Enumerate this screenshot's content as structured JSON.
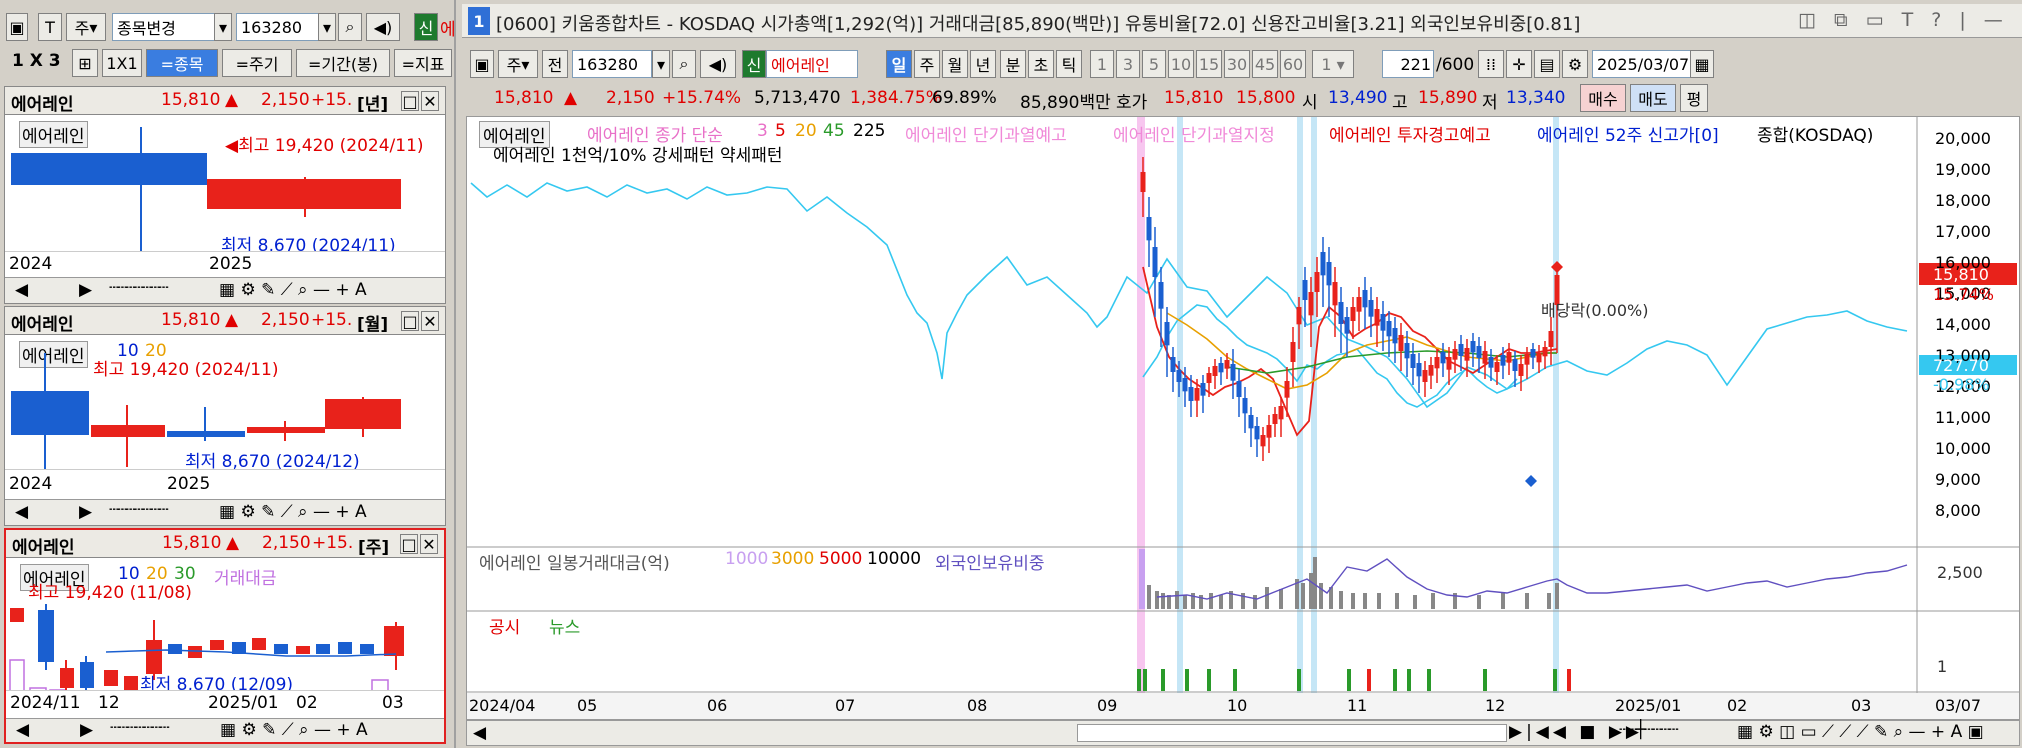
{
  "left": {
    "toolbar": {
      "mode_label": "주",
      "code_label": "종목변경",
      "code_value": "163280",
      "new_badge": "신",
      "trail": "에"
    },
    "row2": {
      "layout": "1 X 3",
      "layout_btn": "1X1",
      "tabs": [
        "=종목",
        "=주기",
        "=기간(봉)",
        "=지표"
      ]
    },
    "panels": [
      {
        "title": "에어레인",
        "price": "15,810",
        "arrow": "▲",
        "change": "2,150",
        "pct": "+15.",
        "period": "[년]",
        "legend_name": "에어레인",
        "ma": [],
        "high_text": "최고 19,420 (2024/11)",
        "low_text": "최저 8,670 (2024/11)",
        "xticks": [
          "2024",
          "2025"
        ]
      },
      {
        "title": "에어레인",
        "price": "15,810",
        "arrow": "▲",
        "change": "2,150",
        "pct": "+15.",
        "period": "[월]",
        "legend_name": "에어레인",
        "ma": [
          "10",
          "20"
        ],
        "high_text": "최고 19,420 (2024/11)",
        "low_text": "최저 8,670 (2024/12)",
        "xticks": [
          "2024",
          "2025"
        ]
      },
      {
        "title": "에어레인",
        "price": "15,810",
        "arrow": "▲",
        "change": "2,150",
        "pct": "+15.",
        "period": "[주]",
        "legend_name": "에어레인",
        "ma": [
          "10",
          "20",
          "30"
        ],
        "extra": "거래대금",
        "high_text": "최고 19,420 (11/08)",
        "low_text": "최저 8,670 (12/09)",
        "xticks": [
          "2024/11",
          "12",
          "2025/01",
          "02",
          "03"
        ]
      }
    ],
    "colors": {
      "up": "#e8221b",
      "down": "#1a5fd0"
    }
  },
  "right": {
    "title": "[0600] 키움종합차트 - KOSDAQ 시가총액[1,292(억)] 거래대금[85,890(백만)] 유통비율[72.0] 신용잔고비율[3.21] 외국인보유비중[0.81]",
    "window_no": "1",
    "toolbar": {
      "mode": "주",
      "prev": "전",
      "code": "163280",
      "new_badge": "신",
      "name": "에어레인",
      "periods": [
        "일",
        "주",
        "월",
        "년",
        "분",
        "초",
        "틱"
      ],
      "numbers": [
        "1",
        "3",
        "5",
        "10",
        "15",
        "30",
        "45",
        "60"
      ],
      "multiplier": "1",
      "count": "221",
      "count_max": "/600",
      "date": "2025/03/07"
    },
    "quote": {
      "price": "15,810",
      "arrow": "▲",
      "change": "2,150",
      "pct": "+15.74%",
      "volume": "5,713,470",
      "vol_ratio": "1,384.75%",
      "turnover": "69.89%",
      "amount": "85,890백만",
      "hoga_label": "호가",
      "hoga1": "15,810",
      "hoga2": "15,800",
      "open_label": "시",
      "open": "13,490",
      "high_label": "고",
      "high": "15,890",
      "low_label": "저",
      "low": "13,340",
      "buy": "매수",
      "sell": "매도",
      "eval": "평"
    },
    "legend1": {
      "name": "에어레인",
      "close_label": "에어레인 종가 단순",
      "ma": [
        "3",
        "5",
        "20",
        "45",
        "225"
      ],
      "warn1": "에어레인 단기과열예고",
      "warn2": "에어레인 단기과열지정",
      "warn3": "에어레인 투자경고예고",
      "new_high": "에어레인 52주 신고가[0]",
      "index": "종합(KOSDAQ)",
      "line2": "에어레인 1천억/10% 강세패턴  약세패턴"
    },
    "legend2": {
      "label": "에어레인 일봉거래대금(억)",
      "levels": [
        "1000",
        "3000",
        "5000",
        "10000"
      ],
      "foreign": "외국인보유비중"
    },
    "legend3": {
      "disclosure": "공시",
      "news": "뉴스"
    },
    "annotation": "배당락(0.00%)",
    "price_axis": [
      "20,000",
      "19,000",
      "18,000",
      "17,000",
      "16,000",
      "15,000",
      "14,000",
      "13,000",
      "12,000",
      "11,000",
      "10,000",
      "9,000",
      "8,000"
    ],
    "price_tag": "15,810",
    "pct_tag": "15.74%",
    "index_tag": "727.70",
    "index_pct": "-0.98%",
    "vol_axis": "2,500",
    "news_axis": "1",
    "xticks": [
      "2024/04",
      "05",
      "06",
      "07",
      "08",
      "09",
      "10",
      "11",
      "12",
      "2025/01",
      "02",
      "03",
      "03/07"
    ],
    "colors": {
      "up": "#e8221b",
      "down": "#1a5fd0",
      "index": "#35c8f0",
      "ma5": "#e8221b",
      "ma20": "#e8a000",
      "ma45": "#2a9a2a"
    }
  }
}
